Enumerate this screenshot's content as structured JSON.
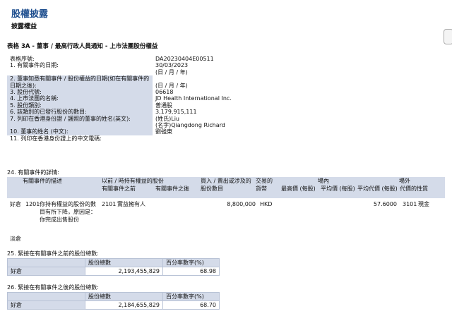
{
  "header": {
    "title": "股權披露",
    "subtitle": "披露權益",
    "form_title": "表格 3A - 董事 / 最高行政人員通知 - 上市法團股份權益"
  },
  "fields": [
    {
      "k": "表格序號:",
      "v": "DA20230404E00511",
      "shade": false
    },
    {
      "k": "1. 有關事件的日期:",
      "v": "30/03/2023",
      "v2": "(日 / 月 / 年)",
      "shade": false,
      "tall": true
    },
    {
      "k": "2. 董事知悉有關事件 / 股份權益的日期(如在有關事件的日期之後):",
      "v": "(日 / 月 / 年)",
      "shade": true,
      "tall": true
    },
    {
      "k": "3. 股份代號:",
      "v": "06618",
      "shade": true
    },
    {
      "k": "4. 上市法團的名稱:",
      "v": "JD Health International Inc.",
      "shade": true
    },
    {
      "k": "5. 股份類別:",
      "v": "普通股",
      "shade": true
    },
    {
      "k": "6. 該類別的已發行股份的數目:",
      "v": "3,179,915,111",
      "shade": true
    },
    {
      "k": "7. 列印在香港身份證 / 護照的董事的姓名(英文):",
      "v": "(姓氏)Liu",
      "v2": "(名字)Qiangdong Richard",
      "shade": true,
      "tall": true
    },
    {
      "k": "10. 董事的姓名 (中文):",
      "v": "劉強東",
      "shade": true
    },
    {
      "k": "11. 列印在香港身份證上的中文電碼:",
      "v": "",
      "shade": false
    }
  ],
  "section24": {
    "title": "24. 有關事件的詳情:",
    "headers": {
      "event_desc": "有關事件的描述",
      "before_after": "以前 / 時持有權益的股份",
      "before": "有關事件之前",
      "after": "有關事件之後",
      "num_shares": "買入 / 賣出或涉及的股份數目",
      "currency": "交易的貨幣",
      "onex": "場內",
      "hi": "最高價 (每股)",
      "avg": "平均價 (每股)",
      "offex": "場外",
      "offavg": "平均代價 (每股)",
      "nature": "代價的性質"
    },
    "row": {
      "pos": "好倉",
      "code": "1201",
      "desc": "你持有權益的股份的數目有所下降，原因是：你完成出售股份",
      "cap": "2101",
      "cap_desc": "實益擁有人",
      "shares": "8,800,000",
      "currency": "HKD",
      "off_avg": "57.6000",
      "nature_code": "3101",
      "nature": "現金"
    },
    "short_label": "淡倉"
  },
  "section25": {
    "title": "25. 緊接在有關事件之前的股份總數:",
    "col1": "股份總數",
    "col2": "百分率數字(%)",
    "label": "好倉",
    "total": "2,193,455,829",
    "pct": "68.98"
  },
  "section26": {
    "title": "26. 緊接在有關事件之後的股份總數:",
    "col1": "股份總數",
    "col2": "百分率數字(%)",
    "label": "好倉",
    "total": "2,184,655,829",
    "pct": "68.70"
  }
}
